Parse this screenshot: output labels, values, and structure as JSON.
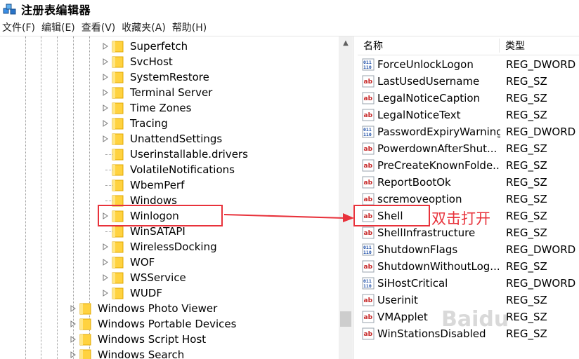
{
  "window": {
    "title": "注册表编辑器",
    "icon": "registry-editor-icon"
  },
  "menu": [
    "文件(F)",
    "编辑(E)",
    "查看(V)",
    "收藏夹(A)",
    "帮助(H)"
  ],
  "tree": {
    "level2_items": [
      {
        "label": "Superfetch",
        "expandable": true
      },
      {
        "label": "SvcHost",
        "expandable": true
      },
      {
        "label": "SystemRestore",
        "expandable": true
      },
      {
        "label": "Terminal Server",
        "expandable": true
      },
      {
        "label": "Time Zones",
        "expandable": true
      },
      {
        "label": "Tracing",
        "expandable": true
      },
      {
        "label": "UnattendSettings",
        "expandable": true
      },
      {
        "label": "Userinstallable.drivers",
        "expandable": false
      },
      {
        "label": "VolatileNotifications",
        "expandable": false
      },
      {
        "label": "WbemPerf",
        "expandable": false
      },
      {
        "label": "Windows",
        "expandable": false
      },
      {
        "label": "Winlogon",
        "expandable": true
      },
      {
        "label": "WinSATAPI",
        "expandable": false
      },
      {
        "label": "WirelessDocking",
        "expandable": true
      },
      {
        "label": "WOF",
        "expandable": true
      },
      {
        "label": "WSService",
        "expandable": true
      },
      {
        "label": "WUDF",
        "expandable": true
      }
    ],
    "level1_items": [
      {
        "label": "Windows Photo Viewer",
        "expandable": true
      },
      {
        "label": "Windows Portable Devices",
        "expandable": true
      },
      {
        "label": "Windows Script Host",
        "expandable": true
      },
      {
        "label": "Windows Search",
        "expandable": true
      }
    ]
  },
  "list": {
    "header_name": "名称",
    "header_type": "类型",
    "rows": [
      {
        "name": "ForceUnlockLogon",
        "type": "REG_DWORD",
        "icon": "dword"
      },
      {
        "name": "LastUsedUsername",
        "type": "REG_SZ",
        "icon": "sz"
      },
      {
        "name": "LegalNoticeCaption",
        "type": "REG_SZ",
        "icon": "sz"
      },
      {
        "name": "LegalNoticeText",
        "type": "REG_SZ",
        "icon": "sz"
      },
      {
        "name": "PasswordExpiryWarning",
        "type": "REG_DWORD",
        "icon": "dword"
      },
      {
        "name": "PowerdownAfterShut...",
        "type": "REG_SZ",
        "icon": "sz"
      },
      {
        "name": "PreCreateKnownFolde...",
        "type": "REG_SZ",
        "icon": "sz"
      },
      {
        "name": "ReportBootOk",
        "type": "REG_SZ",
        "icon": "sz"
      },
      {
        "name": "scremoveoption",
        "type": "REG_SZ",
        "icon": "sz"
      },
      {
        "name": "Shell",
        "type": "REG_SZ",
        "icon": "sz"
      },
      {
        "name": "ShellInfrastructure",
        "type": "REG_SZ",
        "icon": "sz"
      },
      {
        "name": "ShutdownFlags",
        "type": "REG_DWORD",
        "icon": "dword"
      },
      {
        "name": "ShutdownWithoutLog...",
        "type": "REG_SZ",
        "icon": "sz"
      },
      {
        "name": "SiHostCritical",
        "type": "REG_DWORD",
        "icon": "dword"
      },
      {
        "name": "Userinit",
        "type": "REG_SZ",
        "icon": "sz"
      },
      {
        "name": "VMApplet",
        "type": "REG_SZ",
        "icon": "sz"
      },
      {
        "name": "WinStationsDisabled",
        "type": "REG_SZ",
        "icon": "sz"
      }
    ]
  },
  "annotation": {
    "text": "双击打开",
    "color": "#e8323b"
  },
  "watermark": "Baidu"
}
